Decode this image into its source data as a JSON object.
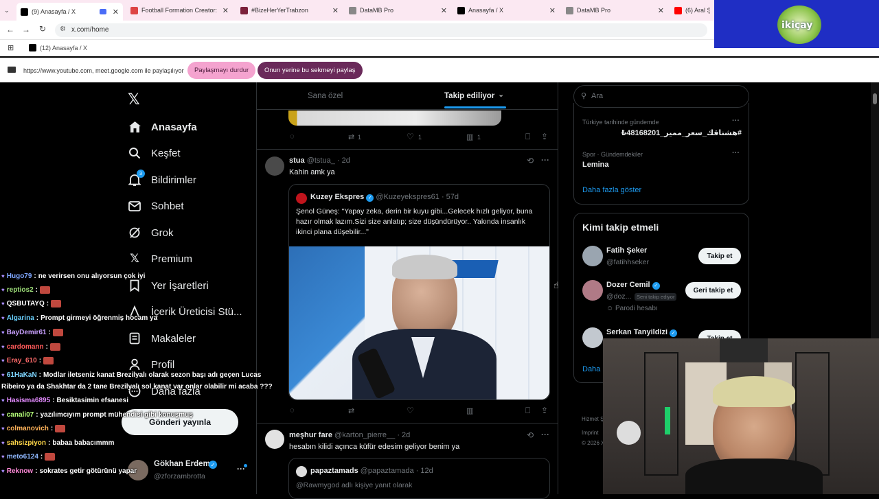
{
  "browser": {
    "tabs": [
      {
        "label": "(9) Anasayfa / X",
        "active": true
      },
      {
        "label": "Football Formation Creator: Re..."
      },
      {
        "label": "#BizeHerYerTrabzon"
      },
      {
        "label": "DataMB Pro"
      },
      {
        "label": "Anasayfa / X"
      },
      {
        "label": "DataMB Pro"
      },
      {
        "label": "(6) Aral Şim..."
      }
    ],
    "url": "x.com/home",
    "bookmark": "(12) Anasayfa / X",
    "share_text": "https://www.youtube.com, meet.google.com ile paylaşılıyor",
    "stop_sharing": "Paylaşmayı durdur",
    "share_this_tab": "Onun yerine bu sekmeyi paylaş"
  },
  "overlay_logo": "ikiçay",
  "x": {
    "nav": [
      {
        "label": "Anasayfa",
        "icon": "home-icon"
      },
      {
        "label": "Keşfet",
        "icon": "search-icon"
      },
      {
        "label": "Bildirimler",
        "icon": "bell-icon",
        "badge": "3"
      },
      {
        "label": "Sohbet",
        "icon": "mail-icon"
      },
      {
        "label": "Grok",
        "icon": "grok-icon"
      },
      {
        "label": "Premium",
        "icon": "x-icon"
      },
      {
        "label": "Yer İşaretleri",
        "icon": "bookmark-icon"
      },
      {
        "label": "İçerik Üreticisi Stü...",
        "icon": "creator-icon"
      },
      {
        "label": "Makaleler",
        "icon": "article-icon"
      },
      {
        "label": "Profil",
        "icon": "profile-icon"
      },
      {
        "label": "Daha fazla",
        "icon": "more-icon"
      }
    ],
    "post_button": "Gönderi yayınla",
    "account": {
      "name": "Gökhan Erdem",
      "handle": "@zforzambrotta"
    },
    "feed_tabs": {
      "for_you": "Sana özel",
      "following": "Takip ediliyor"
    },
    "top_tweet_actions": {
      "retweets": "1",
      "likes": "1",
      "views": "1"
    },
    "tweet1": {
      "name": "stua",
      "handle": "@tstua_",
      "time": "· 2d",
      "text": "Kahin amk ya",
      "quote": {
        "name": "Kuzey Ekspres",
        "handle": "@Kuzeyekspres61",
        "time": "· 57d",
        "text": "Şenol Güneş: \"Yapay zeka, derin bir kuyu gibi...Gelecek hızlı geliyor, buna hazır olmak lazım.Sizi size anlatıp; size düşündürüyor.. Yakında insanlık ikinci plana düşebilir...\""
      }
    },
    "tweet2": {
      "name": "meşhur fare",
      "handle": "@karton_pierre__",
      "time": "· 2d",
      "text": "hesabın kilidi açınca küfür edesim geliyor benim ya",
      "quote": {
        "name": "papaztamads",
        "handle": "@papaztamada",
        "time": "· 12d",
        "text": "@Rawmygod adlı kişiye yanıt olarak"
      }
    },
    "search_placeholder": "Ara",
    "trends": [
      {
        "context": "Türkiye tarihinde gündemde",
        "name": "#هشناقك_سعر_مميز_48168201₺"
      },
      {
        "context": "Spor · Gündemdekiler",
        "name": "Lemina"
      }
    ],
    "show_more": "Daha fazla göster",
    "who_to_follow": {
      "title": "Kimi takip etmeli",
      "users": [
        {
          "name": "Fatih Şeker",
          "handle": "@fatihhseker",
          "button": "Takip et"
        },
        {
          "name": "Dozer Cemil",
          "handle": "@doz...",
          "follows_you": "Seni takip ediyor",
          "note": "Parodi hesabı",
          "button": "Geri takip et"
        },
        {
          "name": "Serkan Tanyildizi",
          "button": "Takip et"
        }
      ],
      "more": "Daha"
    },
    "footer": [
      "Hizmet Ş",
      "Imprint",
      "© 2026 X"
    ]
  },
  "chat": [
    {
      "user": "Hugo79",
      "msg": "ne verirsen onu alıyorsun çok iyi",
      "color": "#7ea6ff"
    },
    {
      "user": "reptios2",
      "msg": "",
      "color": "#9fe07a",
      "emote": true
    },
    {
      "user": "QSBUTAYQ",
      "msg": "",
      "color": "#fff",
      "emote": true
    },
    {
      "user": "Algarina",
      "msg": "Prompt girmeyi öğrenmiş hocam ya",
      "color": "#6ad1ff"
    },
    {
      "user": "BayDemir61",
      "msg": "",
      "color": "#c9a0ff",
      "emote": true
    },
    {
      "user": "cardomann",
      "msg": "",
      "color": "#ff5a5a",
      "emote": true
    },
    {
      "user": "Eray_610",
      "msg": "",
      "color": "#ff6b6b",
      "emote": true
    },
    {
      "user": "61HaKaN",
      "msg": "Modlar iletseniz kanat Brezilyalı olarak sezon başı adı geçen Lucas",
      "color": "#7ed6ff"
    },
    {
      "user": "",
      "msg": "Ribeiro ya da Shakhtar da 2 tane Brezilyalı sol kanat var onlar olabilir mi acaba ???",
      "color": "#fff"
    },
    {
      "user": "Hasisma6895",
      "msg": "Besiktasimin efsanesi",
      "color": "#e38bff"
    },
    {
      "user": "canali07",
      "msg": "yazılımcıyım prompt mühendisi gibi konuşmuş",
      "color": "#b6ff7a"
    },
    {
      "user": "colmanovich",
      "msg": "",
      "color": "#ffb35a",
      "emote": true
    },
    {
      "user": "sahsizpiyon",
      "msg": "babaa babacımmm",
      "color": "#ffd84a"
    },
    {
      "user": "meto6124",
      "msg": "",
      "color": "#8fb8ff",
      "emote": true
    },
    {
      "user": "Reknow",
      "msg": "sokrates getir götürünü yapar",
      "color": "#ff8ad8"
    }
  ],
  "colors": {
    "accent": "#1d9bf0",
    "pink": "#f4a3cf",
    "purple": "#6a2a5a"
  }
}
